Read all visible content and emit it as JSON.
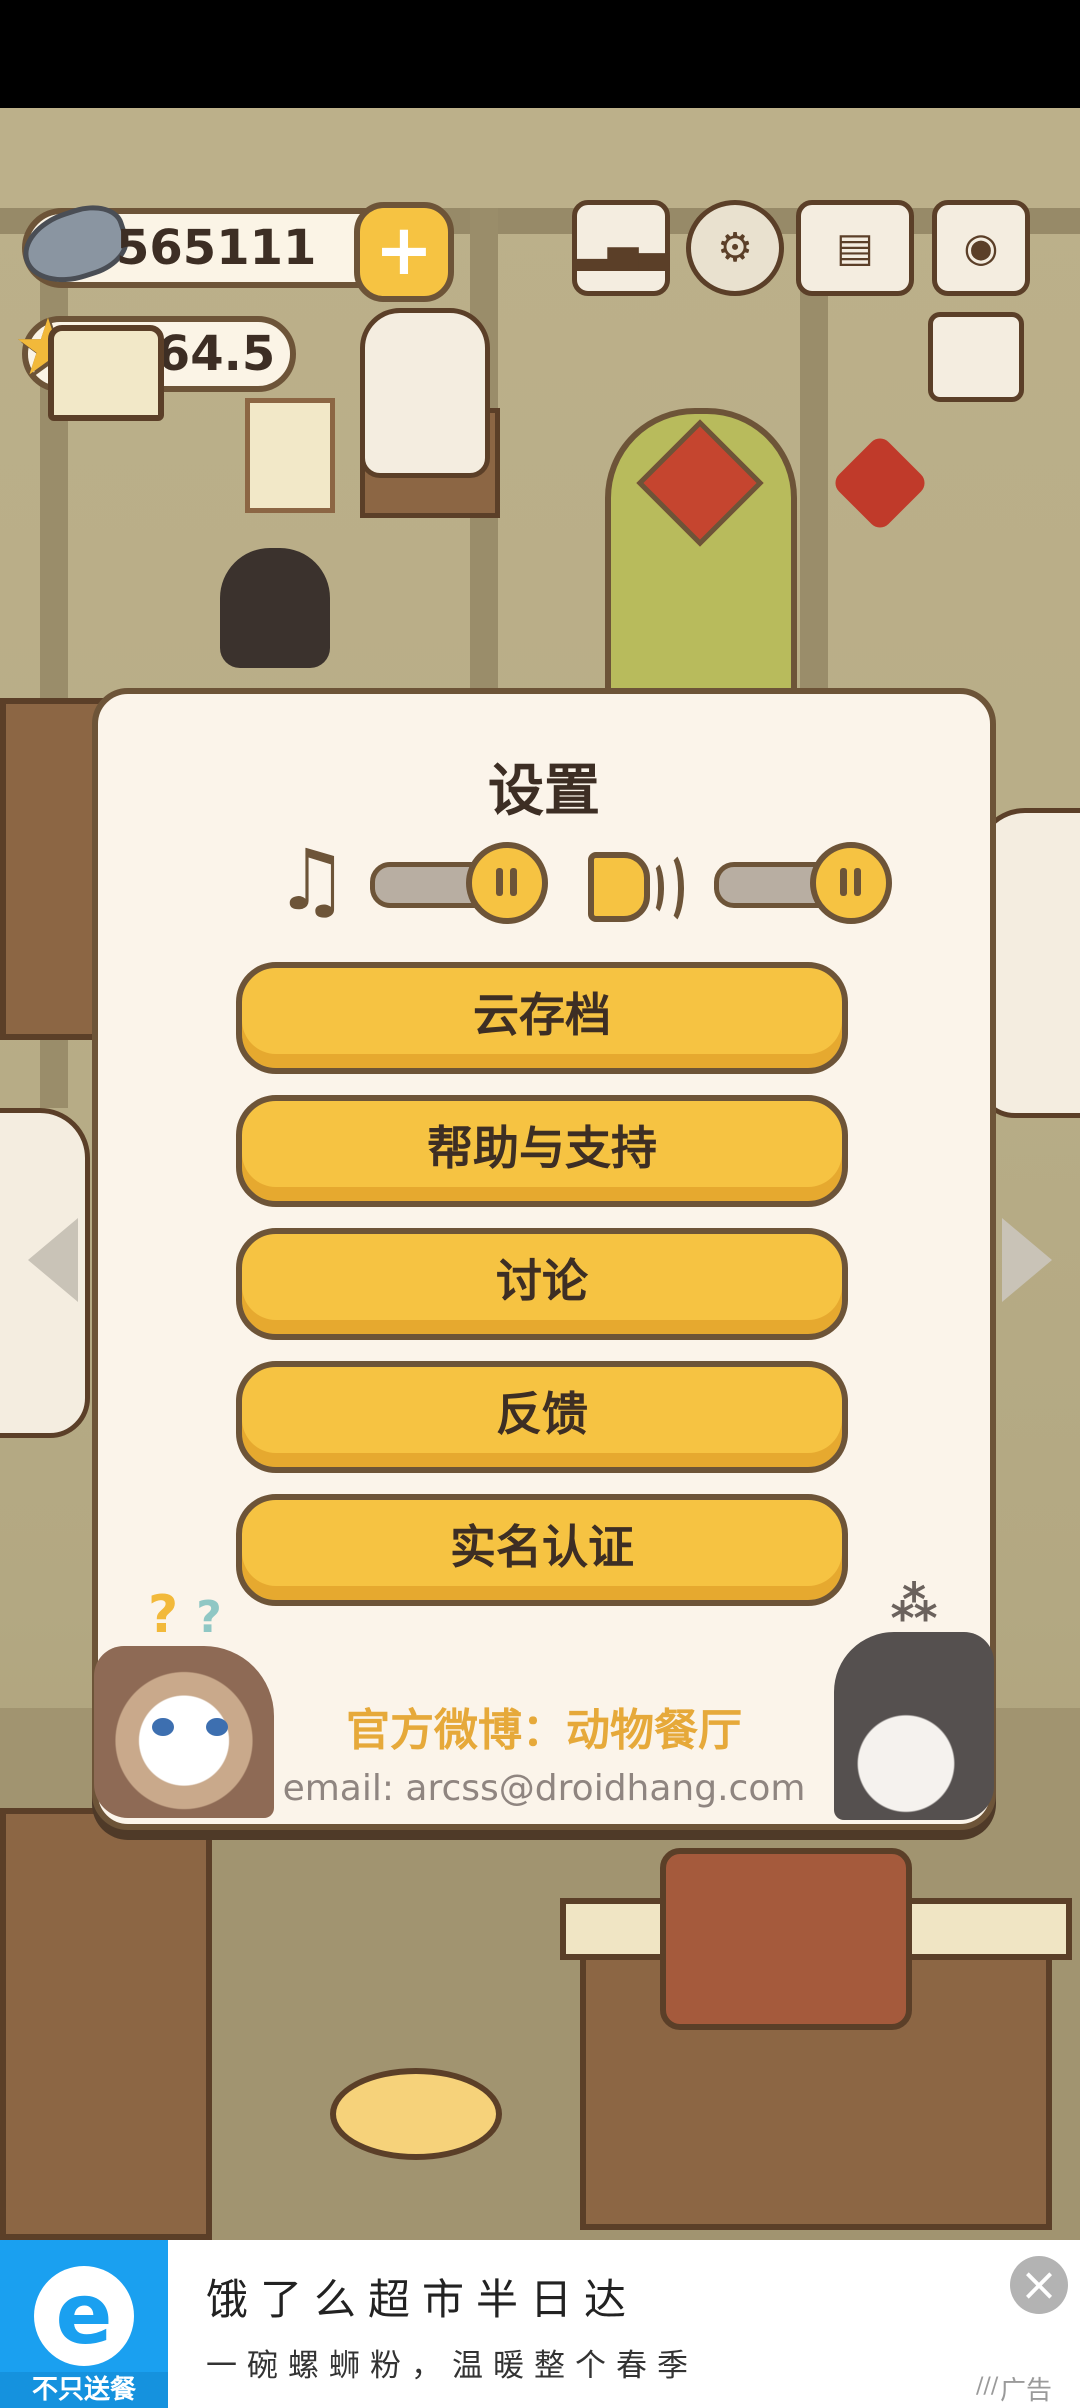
{
  "hud": {
    "fish_count": "565111",
    "star_count": "3864.5"
  },
  "settings": {
    "title": "设置",
    "music_on": true,
    "sound_on": true,
    "buttons": [
      "云存档",
      "帮助与支持",
      "讨论",
      "反馈",
      "实名认证"
    ],
    "weibo": "官方微博：动物餐厅",
    "email": "email: arcss@droidhang.com"
  },
  "ad": {
    "logo_text": "不只送餐",
    "title": "饿了么超市半日达",
    "subtitle": "一碗螺蛳粉，温暖整个春季",
    "label": "广告"
  },
  "colors": {
    "button_yellow": "#f6c342",
    "outline_brown": "#6d5438",
    "dialog_bg": "#fbf4ea",
    "ad_blue": "#1aa0f0"
  }
}
